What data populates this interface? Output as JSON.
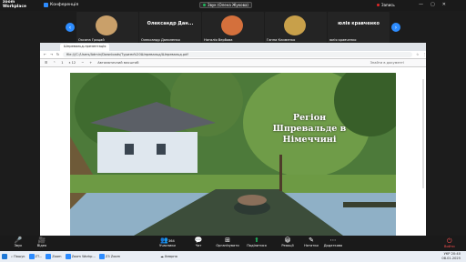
{
  "app": {
    "logo_top": "zoom",
    "logo_bottom": "Workplace",
    "conference_label": "Конференція",
    "share_badge": "Звук (Олена Жукова)",
    "record_label": "Запись"
  },
  "window_controls": [
    "—",
    "▢",
    "✕"
  ],
  "gallery": [
    {
      "avatar_text": "",
      "name": "Оксана Грицай",
      "color": "#c9a06a"
    },
    {
      "avatar_text": "Олександр Дан...",
      "name": "Олександр Даниленко",
      "color": ""
    },
    {
      "avatar_text": "",
      "name": "Наталія Вербова",
      "color": "#d4703c"
    },
    {
      "avatar_text": "",
      "name": "Ганна Клименко",
      "color": "#c8a04a"
    },
    {
      "avatar_text": "юлія кравченко",
      "name": "юлія кравченко",
      "color": ""
    },
    {
      "avatar_text": "",
      "name": "Володимир Казанов",
      "color": "#6e8fb3"
    }
  ],
  "browser": {
    "tab_label": "Шпревальд-презентація",
    "url": "file:///C:/Users/Admin/Downloads/Туризм%20Шпревальд/Шпревальд.pdf",
    "pdf_toolbar": [
      "☰",
      "⌃",
      "1",
      "з 12",
      "−",
      "+",
      "Автоматичний масштаб"
    ],
    "pdf_search": "Знайти в документі"
  },
  "slide": {
    "title": "Регіон Шпревальде в Німеччині"
  },
  "controls": [
    {
      "icon": "🎤",
      "label": "Звук",
      "name": "mic"
    },
    {
      "icon": "🎥",
      "label": "Відео",
      "name": "video"
    },
    {
      "icon": "👥",
      "label": "Учасники",
      "name": "participants"
    },
    {
      "icon": "💬",
      "label": "Чат",
      "name": "chat"
    },
    {
      "icon": "⊞",
      "label": "Організувати",
      "name": "organize"
    },
    {
      "icon": "⬆",
      "label": "Поділитися",
      "name": "share"
    },
    {
      "icon": "😀",
      "label": "Реакції",
      "name": "reactions"
    },
    {
      "icon": "✎",
      "label": "Нотатки",
      "name": "notes"
    },
    {
      "icon": "⋯",
      "label": "Додатково",
      "name": "more"
    }
  ],
  "participants_count": "364",
  "exit_label": "Вийти",
  "taskbar": {
    "items": [
      "Пошук",
      "ZT...",
      "Zoom",
      "Zoom Workp...",
      "Z3 Zoom"
    ],
    "weather": "Хмарно",
    "lang": "УКР",
    "time": "20:40",
    "date": "08.01.2025"
  }
}
